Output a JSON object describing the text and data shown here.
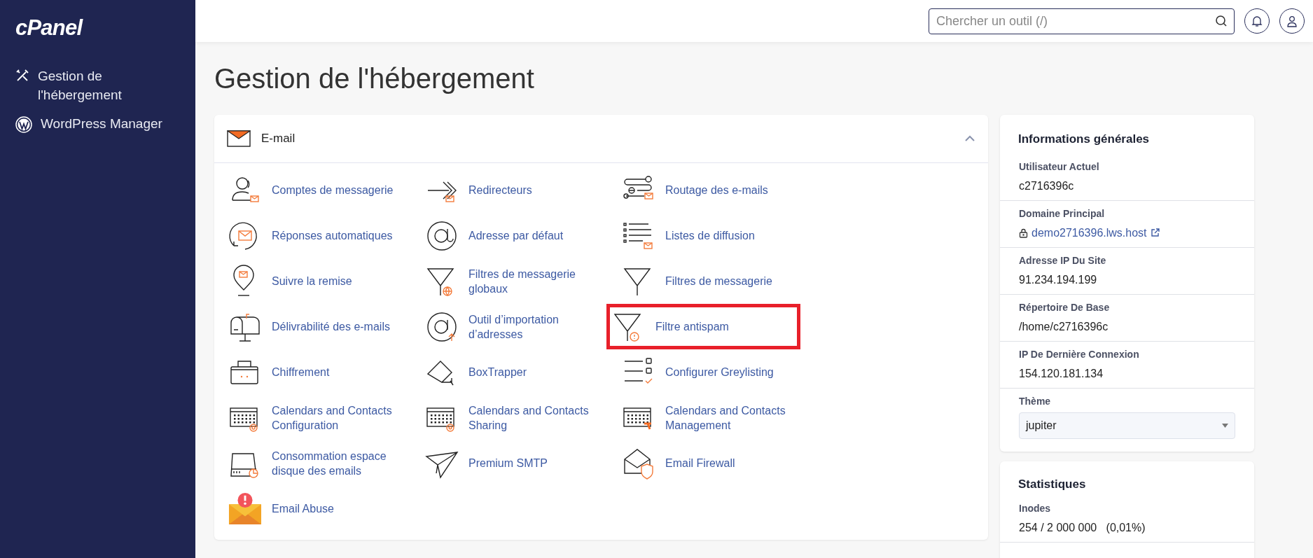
{
  "sidebar": {
    "logo": "cPanel",
    "items": [
      {
        "label": "Gestion de l'hébergement"
      },
      {
        "label": "WordPress Manager"
      }
    ]
  },
  "search": {
    "placeholder": "Chercher un outil (/)"
  },
  "page_title": "Gestion de l'hébergement",
  "email_section": {
    "title": "E-mail",
    "expanded": true,
    "tools": [
      {
        "label": "Comptes de messagerie",
        "highlighted": false
      },
      {
        "label": "Redirecteurs",
        "highlighted": false
      },
      {
        "label": "Routage des e-mails",
        "highlighted": false
      },
      {
        "label": "Réponses automatiques",
        "highlighted": false
      },
      {
        "label": "Adresse par défaut",
        "highlighted": false
      },
      {
        "label": "Listes de diffusion",
        "highlighted": false
      },
      {
        "label": "Suivre la remise",
        "highlighted": false
      },
      {
        "label": "Filtres de messagerie globaux",
        "highlighted": false
      },
      {
        "label": "Filtres de messagerie",
        "highlighted": false
      },
      {
        "label": "Délivrabilité des e-mails",
        "highlighted": false
      },
      {
        "label": "Outil d’importation d’adresses",
        "highlighted": false
      },
      {
        "label": "Filtre antispam",
        "highlighted": true
      },
      {
        "label": "Chiffrement",
        "highlighted": false
      },
      {
        "label": "BoxTrapper",
        "highlighted": false
      },
      {
        "label": "Configurer Greylisting",
        "highlighted": false
      },
      {
        "label": "Calendars and Contacts Configuration",
        "highlighted": false
      },
      {
        "label": "Calendars and Contacts Sharing",
        "highlighted": false
      },
      {
        "label": "Calendars and Contacts Management",
        "highlighted": false
      },
      {
        "label": "Consommation espace disque des emails",
        "highlighted": false
      },
      {
        "label": "Premium SMTP",
        "highlighted": false
      },
      {
        "label": "Email Firewall",
        "highlighted": false
      },
      {
        "label": "Email Abuse",
        "highlighted": false
      }
    ]
  },
  "general_info": {
    "title": "Informations générales",
    "fields": [
      {
        "label": "Utilisateur Actuel",
        "value": "c2716396c",
        "kind": "text"
      },
      {
        "label": "Domaine Principal",
        "value": "demo2716396.lws.host",
        "kind": "link"
      },
      {
        "label": "Adresse IP Du Site",
        "value": "91.234.194.199",
        "kind": "text"
      },
      {
        "label": "Répertoire De Base",
        "value": "/home/c2716396c",
        "kind": "text"
      },
      {
        "label": "IP De Dernière Connexion",
        "value": "154.120.181.134",
        "kind": "text"
      },
      {
        "label": "Thème",
        "value": "jupiter",
        "kind": "select"
      }
    ]
  },
  "statistics": {
    "title": "Statistiques",
    "fields": [
      {
        "label": "Inodes",
        "value": "254 / 2 000 000   (0,01%)"
      }
    ]
  }
}
